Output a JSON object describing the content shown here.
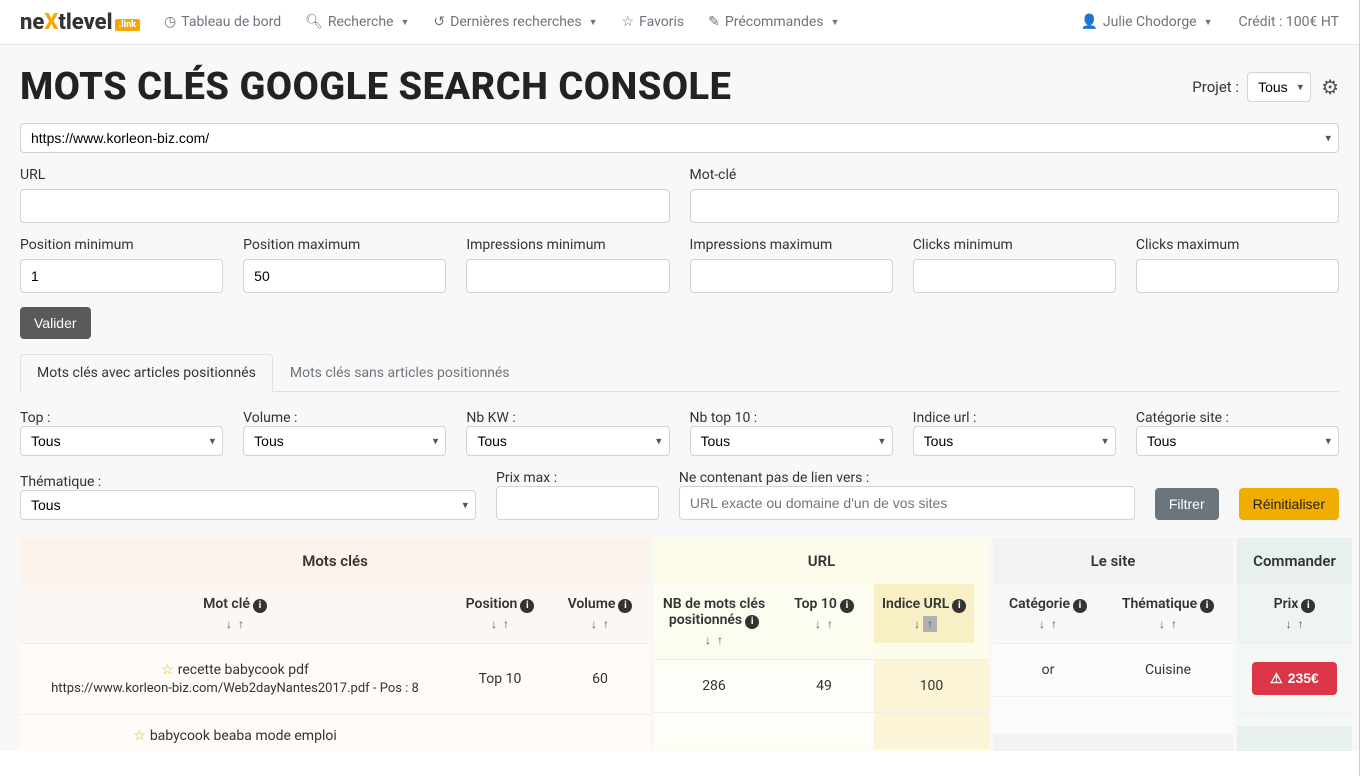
{
  "nav": {
    "dashboard": "Tableau de bord",
    "search": "Recherche",
    "recent": "Dernières recherches",
    "favorites": "Favoris",
    "preorders": "Précommandes",
    "user": "Julie Chodorge",
    "credit": "Crédit : 100€ HT"
  },
  "page": {
    "title": "MOTS CLÉS GOOGLE SEARCH CONSOLE",
    "projet_label": "Projet :",
    "projet_value": "Tous",
    "site_select": "https://www.korleon-biz.com/"
  },
  "filters": {
    "url_label": "URL",
    "motcle_label": "Mot-clé",
    "posmin_label": "Position minimum",
    "posmin_value": "1",
    "posmax_label": "Position maximum",
    "posmax_value": "50",
    "impmin_label": "Impressions minimum",
    "impmax_label": "Impressions maximum",
    "clickmin_label": "Clicks minimum",
    "clickmax_label": "Clicks maximum",
    "valider": "Valider"
  },
  "tabs": {
    "with": "Mots clés avec articles positionnés",
    "without": "Mots clés sans articles positionnés"
  },
  "filters2": {
    "top": "Top :",
    "volume": "Volume :",
    "nbkw": "Nb KW :",
    "nbtop10": "Nb top 10 :",
    "indice": "Indice url :",
    "categorie": "Catégorie site :",
    "thematique": "Thématique :",
    "prixmax": "Prix max :",
    "nolien": "Ne contenant pas de lien vers :",
    "nolien_placeholder": "URL exacte ou domaine d'un de vos sites",
    "tous": "Tous",
    "filtrer": "Filtrer",
    "reset": "Réinitialiser"
  },
  "groups": {
    "g1": "Mots clés",
    "g2": "URL",
    "g3": "Le site",
    "g4": "Commander"
  },
  "cols": {
    "motcle": "Mot clé",
    "position": "Position",
    "volume": "Volume",
    "nbkw": "NB de mots clés positionnés",
    "top10": "Top 10",
    "indice": "Indice URL",
    "categorie": "Catégorie",
    "thematique": "Thématique",
    "prix": "Prix"
  },
  "rows": [
    {
      "kw": "recette babycook pdf",
      "url_line": "https://www.korleon-biz.com/Web2dayNantes2017.pdf - Pos : 8",
      "position": "Top 10",
      "volume": "60",
      "nbkw": "286",
      "top10": "49",
      "indice": "100",
      "categorie": "or",
      "thematique": "Cuisine",
      "prix": "235€"
    }
  ],
  "partial_row_kw": "babycook beaba mode emploi"
}
